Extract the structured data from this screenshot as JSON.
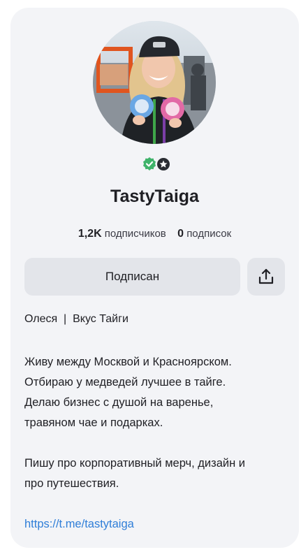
{
  "profile": {
    "username": "TastyTaiga",
    "followers_count": "1,2K",
    "followers_label": "подписчиков",
    "following_count": "0",
    "following_label": "подписок",
    "name_line": "Олеся  |  Вкус Тайги",
    "link": "https://t.me/tastytaiga"
  },
  "actions": {
    "subscribe_label": "Подписан",
    "share_icon": "share-upload-icon"
  },
  "badges": [
    "verified-icon",
    "star-badge-icon"
  ],
  "bio": {
    "paragraph1": [
      "Живу между Москвой и Красноярском.",
      "Отбираю у медведей лучшее в тайге.",
      "Делаю бизнес с душой на варенье,",
      "травяном чае и подарках."
    ],
    "paragraph2": [
      "Пишу про корпоративный мерч, дизайн и",
      "про путешествия."
    ]
  },
  "colors": {
    "card_bg": "#f3f4f7",
    "button_bg": "#e3e5ea",
    "link": "#2f7ed8",
    "verified": "#3fb36a"
  }
}
